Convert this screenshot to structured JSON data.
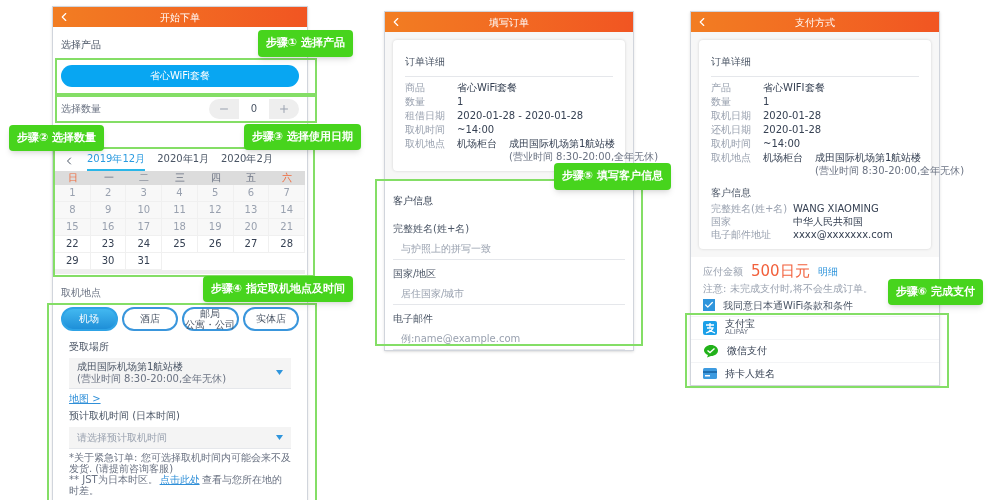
{
  "start_screen": {
    "title": "开始下单",
    "product": {
      "label": "选择产品",
      "option": "省心WiFi套餐",
      "callout": "步骤① 选择产品"
    },
    "quantity": {
      "label": "选择数量",
      "value": "0",
      "callout": "步骤② 选择数量"
    },
    "calendar": {
      "callout": "步骤③ 选择使用日期",
      "months": [
        {
          "label": "2019年12月",
          "selected": true
        },
        {
          "label": "2020年1月",
          "selected": false
        },
        {
          "label": "2020年2月",
          "selected": false
        }
      ],
      "weekdays": [
        {
          "label": "日",
          "weekend": true
        },
        {
          "label": "一",
          "weekend": false
        },
        {
          "label": "二",
          "weekend": false
        },
        {
          "label": "三",
          "weekend": false
        },
        {
          "label": "四",
          "weekend": false
        },
        {
          "label": "五",
          "weekend": false
        },
        {
          "label": "六",
          "weekend": true
        }
      ],
      "weeks": [
        [
          {
            "label": "1",
            "disabled": true
          },
          {
            "label": "2",
            "disabled": true
          },
          {
            "label": "3",
            "disabled": true
          },
          {
            "label": "4",
            "disabled": true
          },
          {
            "label": "5",
            "disabled": true
          },
          {
            "label": "6",
            "disabled": true
          },
          {
            "label": "7",
            "disabled": true
          }
        ],
        [
          {
            "label": "8",
            "disabled": true
          },
          {
            "label": "9",
            "disabled": true
          },
          {
            "label": "10",
            "disabled": true
          },
          {
            "label": "11",
            "disabled": true
          },
          {
            "label": "12",
            "disabled": true
          },
          {
            "label": "13",
            "disabled": true
          },
          {
            "label": "14",
            "disabled": true
          }
        ],
        [
          {
            "label": "15",
            "disabled": true
          },
          {
            "label": "16",
            "disabled": true
          },
          {
            "label": "17",
            "disabled": true
          },
          {
            "label": "18",
            "disabled": true
          },
          {
            "label": "19",
            "disabled": true
          },
          {
            "label": "20",
            "disabled": true
          },
          {
            "label": "21",
            "disabled": true
          }
        ],
        [
          {
            "label": "22",
            "disabled": false
          },
          {
            "label": "23",
            "disabled": false
          },
          {
            "label": "24",
            "disabled": false
          },
          {
            "label": "25",
            "disabled": false
          },
          {
            "label": "26",
            "disabled": false
          },
          {
            "label": "27",
            "disabled": false
          },
          {
            "label": "28",
            "disabled": false
          }
        ],
        [
          {
            "label": "29",
            "disabled": false
          },
          {
            "label": "30",
            "disabled": false
          },
          {
            "label": "31",
            "disabled": false
          }
        ]
      ]
    },
    "pickup": {
      "label": "取机地点",
      "callout": "步骤④ 指定取机地点及时间",
      "options": [
        {
          "label": "机场",
          "selected": true
        },
        {
          "label": "酒店",
          "selected": false
        },
        {
          "label": "邮局",
          "sublabel": "公寓・公司",
          "selected": false
        },
        {
          "label": "实体店",
          "selected": false
        }
      ],
      "place_label": "受取場所",
      "place_value": "成田国际机场第1航站楼",
      "place_hours": "(营业时间 8:30-20:00,全年无休)",
      "map_link": "地图 >",
      "time_label": "预计取机时间 (日本时间)",
      "time_placeholder": "请选择预计取机时间",
      "notes": [
        {
          "text": "*关于紧急订单: 您可选择取机时间内可能会来不及发货. (请提前咨询客服)"
        },
        {
          "text": "** JST为日本时区。",
          "link": "点击此处",
          "after": "查看与您所在地的时差。"
        }
      ]
    }
  },
  "order_screen": {
    "title": "填写订单",
    "order": {
      "title": "订单详细",
      "rows": [
        {
          "label": "商品",
          "value": "省心WiFi套餐"
        },
        {
          "label": "数量",
          "value": "1"
        },
        {
          "label": "租借日期",
          "value": "2020-01-28 - 2020-01-28"
        },
        {
          "label": "取机时间",
          "value": "~14:00"
        },
        {
          "label": "取机地点",
          "value": "机场柜台",
          "detail": "成田国际机场第1航站楼",
          "detail_note": "(营业时间 8:30-20:00,全年无休)"
        }
      ]
    },
    "customer": {
      "title": "客户信息",
      "callout": "步骤⑤ 填写客户信息",
      "fields": [
        {
          "label": "完整姓名(姓+名)",
          "placeholder": "与护照上的拼写一致"
        },
        {
          "label": "国家/地区",
          "placeholder": "居住国家/城市"
        },
        {
          "label": "电子邮件",
          "placeholder": "例:name@example.com"
        }
      ]
    }
  },
  "payment_screen": {
    "title": "支付方式",
    "order": {
      "title": "订单详细",
      "rows": [
        {
          "label": "产品",
          "value": "省心WIFI套餐"
        },
        {
          "label": "数量",
          "value": "1"
        },
        {
          "label": "取机日期",
          "value": "2020-01-28"
        },
        {
          "label": "还机日期",
          "value": "2020-01-28"
        },
        {
          "label": "取机时间",
          "value": "~14:00"
        },
        {
          "label": "取机地点",
          "value": "机场柜台",
          "detail": "成田国际机场第1航站楼",
          "detail_note": "(营业时间 8:30-20:00,全年无休)"
        }
      ]
    },
    "customer": {
      "title": "客户信息",
      "rows": [
        {
          "label": "完整姓名(姓+名)",
          "value": "WANG XIAOMING"
        },
        {
          "label": "国家",
          "value": "中华人民共和国"
        },
        {
          "label": "电子邮件地址",
          "value": "xxxx@xxxxxxx.com"
        }
      ]
    },
    "total": {
      "label": "应付金额",
      "amount": "500日元",
      "link": "明细"
    },
    "note": "注意: 未完成支付时,将不会生成订单。",
    "agreement": {
      "checked": true,
      "label": "我同意日本通WiFi条款和条件"
    },
    "payments": {
      "callout": "步骤⑥ 完成支付",
      "methods": [
        {
          "kind": "alipay",
          "label": "支付宝",
          "sublabel": "ALIPAY"
        },
        {
          "kind": "wechat",
          "label": "微信支付"
        },
        {
          "kind": "card",
          "label": "持卡人姓名"
        }
      ]
    }
  }
}
